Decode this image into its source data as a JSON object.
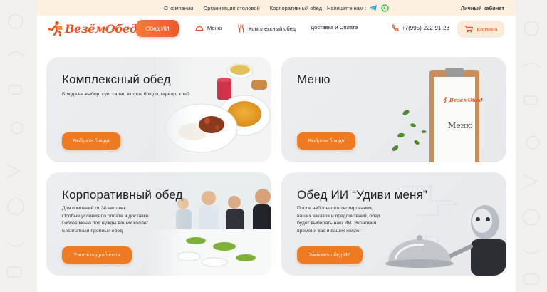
{
  "topbar": {
    "links": [
      "О компании",
      "Организация столовой",
      "Корпоративный обед"
    ],
    "write_us": "Напишите нам :",
    "cabinet": "Личный кабинет"
  },
  "header": {
    "logo_text": "ВезёмОбед",
    "ai_button": "Обед ИИ",
    "nav": {
      "menu": "Меню",
      "complex": "Комплексный обед",
      "delivery": "Доставка и Оплата"
    },
    "phone": "+7(995)-222-91-23",
    "cart": "Корзина"
  },
  "cards": {
    "complex": {
      "title": "Комплексный обед",
      "desc": "Блюда на выбор: суп, салат, второе блюдо, гарнир, хлеб",
      "button": "Выбрать блюдо"
    },
    "menu": {
      "title": "Меню",
      "button": "Выбрать блюдо",
      "board_logo": "ВезёмОбед",
      "board_text": "Меню"
    },
    "corporate": {
      "title": "Корпоративный обед",
      "desc_lines": [
        "Для компаний от 30 человек",
        "Особые условия по оплате и доставке",
        "Гибкое меню под нужды ваших коллег",
        "Бесплатный пробный обед"
      ],
      "button": "Узнать подробности"
    },
    "ai": {
      "title": "Обед ИИ “Удиви меня”",
      "desc_lines": [
        "После небольшого тестирования,",
        "ваших заказов и предпочтений, обед",
        "будет выбирать наш ИИ. Экономия",
        "времени вас и ваших коллег"
      ],
      "button": "Заказать обед ИИ"
    }
  },
  "colors": {
    "accent": "#ef7a24",
    "brand": "#e8501f",
    "card_bg": "#e9ebee"
  }
}
